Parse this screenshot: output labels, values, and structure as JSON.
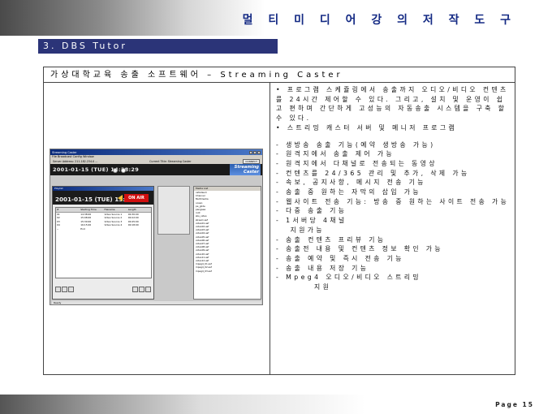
{
  "header": {
    "title": "멀 티 미 디 어  강 의  저 작  도 구"
  },
  "section": {
    "label": "3. DBS Tutor"
  },
  "slide": {
    "title": "가상대학교육 송출 소프트웨어 – Streaming Caster"
  },
  "bullets": [
    "• 프로그램 스케쥴링에서 송출까지 오디오/비디오 컨텐츠를 24시간 제어할 수 있다. 그리고, 설치 및 운영이 쉽고 편하며 간단하게 고성능의 자동송출 시스템을 구축 할 수 있다.",
    "• 스트리밍 캐스터 서버 및 메니저 프로그램"
  ],
  "features": [
    "- 생방송 송출 기능(예약 생방송 가능)",
    "- 원격지에서 송출 제어 가능",
    "- 원격지에서 다채널로 전송되는 동영상",
    "- 컨텐츠를 24/365 관리 및 추가, 삭제 가능",
    "- 속보, 공지사항, 메시지 전송 기능",
    "- 송출 중 원하는 자막의 삽입 가능",
    "- 웹사이트 전송 기능: 방송 중 원하는 사이트 전송 가능",
    "- 다중 송출 기능",
    "- 1서버당 4채널",
    "   지원가능",
    "- 송출 컨텐츠 프리뷰 기능",
    "- 송출전 내용 및 컨텐츠 정보 확인 가능",
    "- 송출 예약 및 즉시 전송 기능",
    "- 송출 내용 저장 기능",
    "- Mpeg4 오디오/비디오 스트리밍",
    "        지원"
  ],
  "screenshot": {
    "window_title": "Streaming Caster",
    "menu": "File  Broadcast  Config  Window",
    "status_left": "Server Address: 211.182.234.0 ...",
    "status_mid": "Current Title: Streaming Caster",
    "connect_label": "CONNECT",
    "clock": "2001-01-15 (TUE) 14:38:29",
    "logo": "Streaming\nCaster",
    "inner_title": "Playlist",
    "inner_clock": "2001-01-15 (TUE) 15:00:00",
    "on_air": "ON AIR",
    "playlist_headers": [
      "#",
      "Starting Time",
      "Filename",
      "Length"
    ],
    "playlist_rows": [
      [
        "01",
        "14:38:00",
        "Video Source 1",
        "00:30:00"
      ],
      [
        "02",
        "15:08:00",
        "Video Source 2",
        "00:22:00"
      ],
      [
        "03",
        "15:30:00",
        "Video Source 3",
        "00:45:00"
      ],
      [
        "04",
        "16:15:00",
        "Video Source 4",
        "00:18:00"
      ],
      [
        "--",
        "End",
        "",
        ""
      ]
    ],
    "side_title": "Media List",
    "files": [
      "cafedaum",
      "Channel",
      "Multimedia",
      "ocean",
      "pe_glide",
      "pangaea",
      "root",
      "sbs_video",
      "stream.asf",
      "video01.asf",
      "video02.asf",
      "video03.asf",
      "video04.asf",
      "video05.asf",
      "video06.asf",
      "video07.asf",
      "video08.asf",
      "video09.asf",
      "video10.asf",
      "video11.asf",
      "video12.asf",
      "mpeg4_01.asf",
      "mpeg4_02.asf",
      "mpeg4_03.asf"
    ],
    "bottom_status": "Ready"
  },
  "footer": {
    "page": "Page 15"
  }
}
